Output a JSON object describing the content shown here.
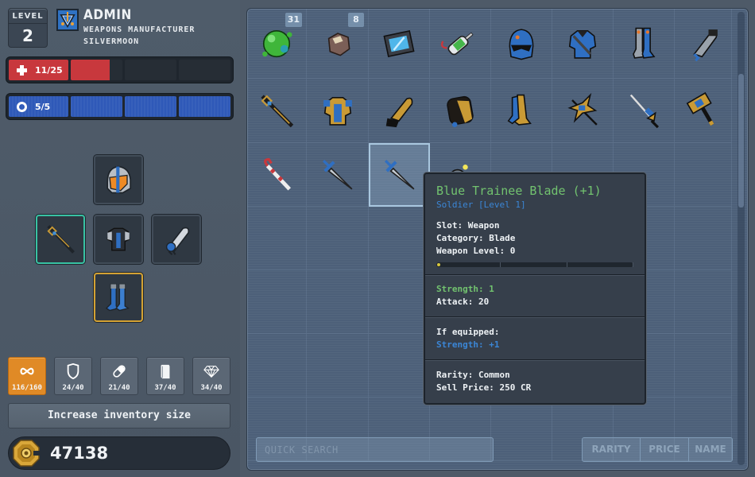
{
  "player": {
    "level_label": "LEVEL",
    "level": "2",
    "name": "ADMIN",
    "title": "WEAPONS MANUFACTURER",
    "location": "SILVERMOON",
    "emblem_icon": "faction-emblem-icon"
  },
  "health": {
    "text": "11/25",
    "current": 11,
    "max": 25,
    "icon": "health-cross-icon",
    "color": "#c8383d"
  },
  "energy": {
    "text": "5/5",
    "current": 5,
    "max": 5,
    "icon": "energy-ring-icon",
    "color": "#2f59b8"
  },
  "equipment": [
    {
      "slot": "head",
      "item": "orange-visor-helmet",
      "selected": false
    },
    {
      "slot": "weapon",
      "item": "gold-chain-spear",
      "selected": true,
      "highlight": "teal"
    },
    {
      "slot": "body",
      "item": "blue-black-armor",
      "selected": false
    },
    {
      "slot": "arms",
      "item": "silver-gauntlet",
      "selected": false
    },
    {
      "slot": "legs",
      "item": "blue-greaves",
      "selected": true,
      "highlight": "gold"
    }
  ],
  "categories": [
    {
      "name": "all",
      "icon": "infinity-icon",
      "count": "116/160",
      "active": true
    },
    {
      "name": "armor",
      "icon": "shield-icon",
      "count": "24/40",
      "active": false
    },
    {
      "name": "consumables",
      "icon": "pill-icon",
      "count": "21/40",
      "active": false
    },
    {
      "name": "books",
      "icon": "book-icon",
      "count": "37/40",
      "active": false
    },
    {
      "name": "gems",
      "icon": "diamond-icon",
      "count": "34/40",
      "active": false
    }
  ],
  "increase_button": "Increase inventory size",
  "credits": {
    "amount": "47138",
    "icon": "credit-coin-icon"
  },
  "inventory": {
    "items": [
      {
        "name": "green-slime",
        "count": "31"
      },
      {
        "name": "ore-rock",
        "count": "8"
      },
      {
        "name": "data-tablet"
      },
      {
        "name": "syringe-injector"
      },
      {
        "name": "blue-helmet"
      },
      {
        "name": "blue-chest-armor"
      },
      {
        "name": "blue-leg-armor"
      },
      {
        "name": "grey-gauntlet"
      },
      {
        "name": "chain-spear"
      },
      {
        "name": "gold-chest-armor"
      },
      {
        "name": "gold-gauntlet"
      },
      {
        "name": "gold-helmet"
      },
      {
        "name": "gold-leg-armor"
      },
      {
        "name": "gold-crossbow"
      },
      {
        "name": "gold-rapier"
      },
      {
        "name": "gold-hammer"
      },
      {
        "name": "candy-cane-sword"
      },
      {
        "name": "steel-blade"
      },
      {
        "name": "blue-trainee-blade",
        "selected": true
      },
      {
        "name": "glowing-orb"
      }
    ],
    "search_placeholder": "QUICK SEARCH",
    "sort_buttons": [
      "RARITY",
      "PRICE",
      "NAME"
    ]
  },
  "tooltip": {
    "title": "Blue Trainee Blade (+1)",
    "subtitle": "Soldier [Level 1]",
    "slot": "Slot: Weapon",
    "category": "Category: Blade",
    "weapon_level": "Weapon Level: 0",
    "weapon_level_progress": 0,
    "strength": "Strength: 1",
    "attack": "Attack: 20",
    "if_equipped_label": "If equipped:",
    "if_equipped_value": "Strength: +1",
    "rarity": "Rarity: Common",
    "sell_price": "Sell Price: 250 CR"
  }
}
